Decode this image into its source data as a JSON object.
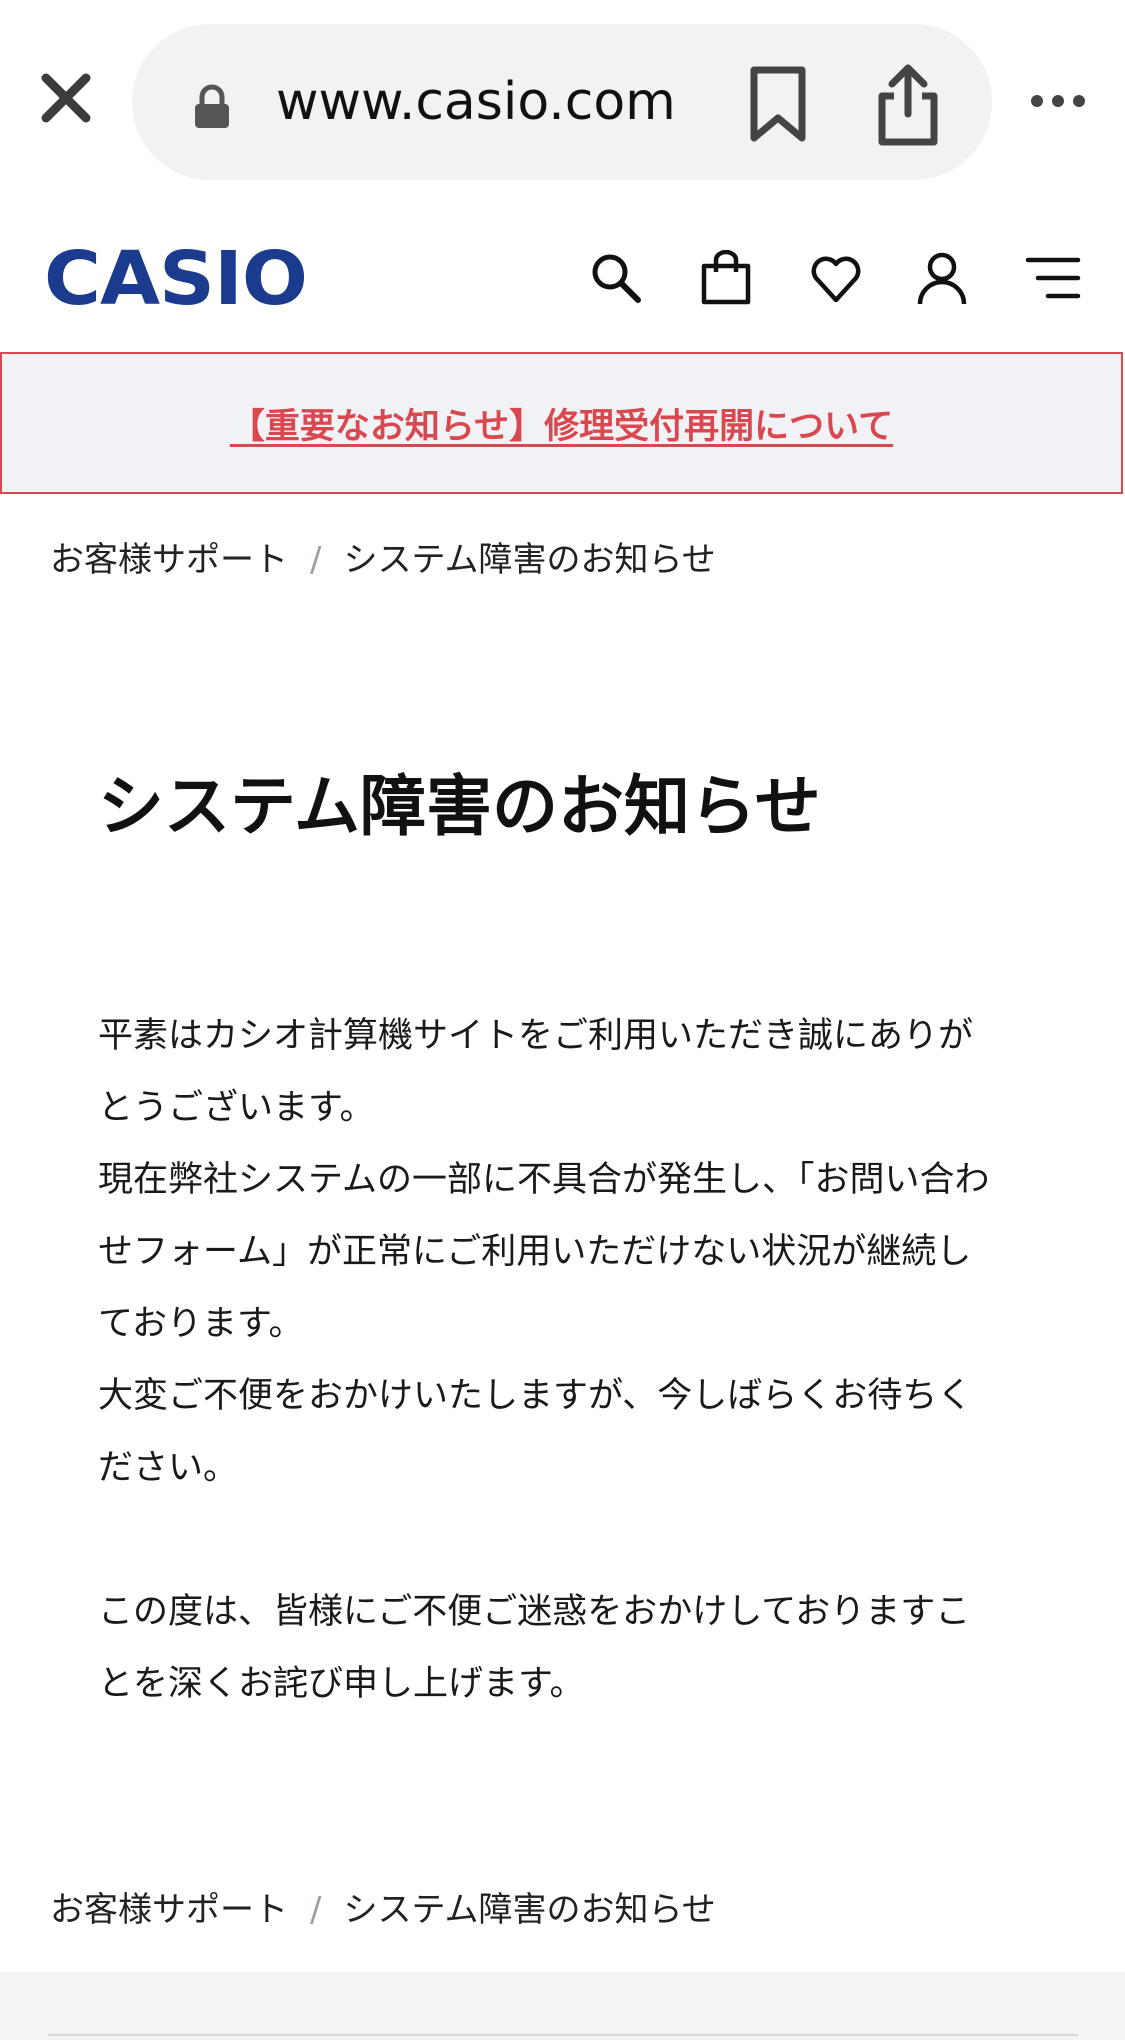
{
  "browser": {
    "url": "www.casio.com"
  },
  "header": {
    "logo_text": "CASIO",
    "brand_color": "#1b3c8e",
    "icons": [
      "search-icon",
      "bag-icon",
      "heart-icon",
      "user-icon",
      "menu-icon"
    ]
  },
  "notice": {
    "text": "【重要なお知らせ】修理受付再開について",
    "color": "#d9484f"
  },
  "breadcrumb": {
    "items": [
      "お客様サポート",
      "システム障害のお知らせ"
    ],
    "separator": "/"
  },
  "main": {
    "title": "システム障害のお知らせ",
    "paragraphs": [
      "平素はカシオ計算機サイトをご利用いただき誠にありがとうございます。",
      "現在弊社システムの一部に不具合が発生し、「お問い合わせフォーム」が正常にご利用いただけない状況が継続しております。",
      "大変ご不便をおかけいたしますが、今しばらくお待ちください。",
      "この度は、皆様にご不便ご迷惑をおかけしておりますことを深くお詫び申し上げます。"
    ]
  }
}
